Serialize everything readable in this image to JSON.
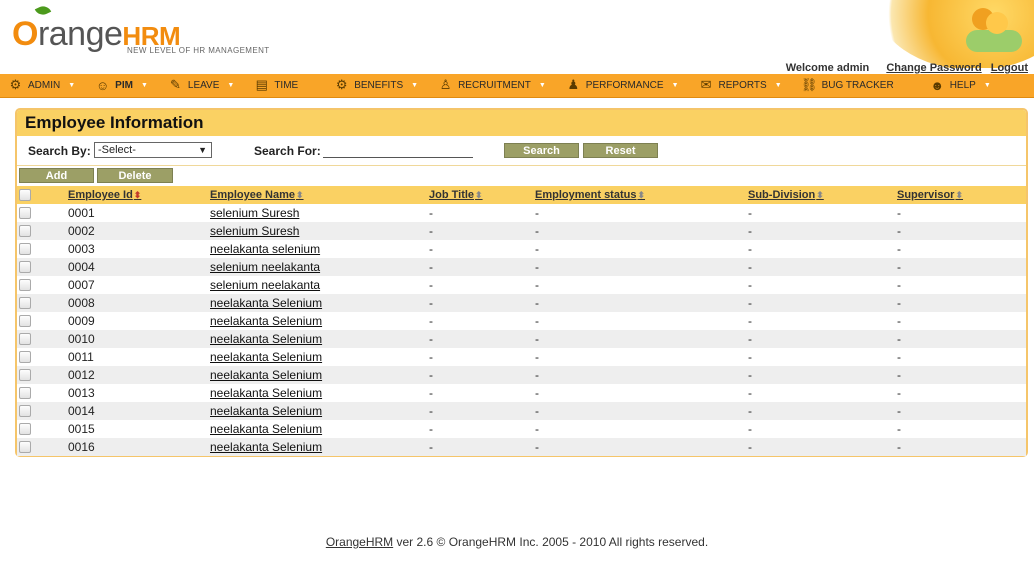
{
  "brand": {
    "logo_prefix": "O",
    "logo_word": "range",
    "logo_suffix": "HRM",
    "tagline": "NEW LEVEL OF HR MANAGEMENT"
  },
  "user_bar": {
    "welcome": "Welcome admin",
    "change_password": "Change Password",
    "logout": "Logout"
  },
  "menu": [
    {
      "label": "Admin",
      "icon": "admin-icon",
      "glyph": "⚙",
      "has_dropdown": true
    },
    {
      "label": "PIM",
      "icon": "pim-icon",
      "glyph": "☺",
      "has_dropdown": true,
      "active": true
    },
    {
      "label": "Leave",
      "icon": "leave-icon",
      "glyph": "✎",
      "has_dropdown": true
    },
    {
      "label": "Time",
      "icon": "time-icon",
      "glyph": "▤",
      "has_dropdown": false
    },
    {
      "label": "Benefits",
      "icon": "benefits-icon",
      "glyph": "⚙",
      "has_dropdown": true
    },
    {
      "label": "Recruitment",
      "icon": "recruitment-icon",
      "glyph": "♙",
      "has_dropdown": true
    },
    {
      "label": "Performance",
      "icon": "performance-icon",
      "glyph": "♟",
      "has_dropdown": true
    },
    {
      "label": "Reports",
      "icon": "reports-icon",
      "glyph": "✉",
      "has_dropdown": true
    },
    {
      "label": "Bug Tracker",
      "icon": "bug-tracker-icon",
      "glyph": "⛓",
      "has_dropdown": false
    },
    {
      "label": "Help",
      "icon": "help-icon",
      "glyph": "☻",
      "has_dropdown": true
    }
  ],
  "panel": {
    "title": "Employee Information",
    "search_by_label": "Search By:",
    "search_by_value": "-Select-",
    "search_for_label": "Search For:",
    "search_for_value": "",
    "search_button": "Search",
    "reset_button": "Reset",
    "add_button": "Add",
    "delete_button": "Delete"
  },
  "table": {
    "columns": [
      "Employee Id",
      "Employee Name",
      "Job Title",
      "Employment status",
      "Sub-Division",
      "Supervisor"
    ],
    "rows": [
      {
        "id": "0001",
        "name": "selenium Suresh",
        "job": "-",
        "status": "-",
        "sub": "-",
        "sup": "-"
      },
      {
        "id": "0002",
        "name": "selenium Suresh",
        "job": "-",
        "status": "-",
        "sub": "-",
        "sup": "-"
      },
      {
        "id": "0003",
        "name": "neelakanta selenium",
        "job": "-",
        "status": "-",
        "sub": "-",
        "sup": "-"
      },
      {
        "id": "0004",
        "name": "selenium neelakanta",
        "job": "-",
        "status": "-",
        "sub": "-",
        "sup": "-"
      },
      {
        "id": "0007",
        "name": "selenium neelakanta",
        "job": "-",
        "status": "-",
        "sub": "-",
        "sup": "-"
      },
      {
        "id": "0008",
        "name": "neelakanta Selenium",
        "job": "-",
        "status": "-",
        "sub": "-",
        "sup": "-"
      },
      {
        "id": "0009",
        "name": "neelakanta Selenium",
        "job": "-",
        "status": "-",
        "sub": "-",
        "sup": "-"
      },
      {
        "id": "0010",
        "name": "neelakanta Selenium",
        "job": "-",
        "status": "-",
        "sub": "-",
        "sup": "-"
      },
      {
        "id": "0011",
        "name": "neelakanta Selenium",
        "job": "-",
        "status": "-",
        "sub": "-",
        "sup": "-"
      },
      {
        "id": "0012",
        "name": "neelakanta Selenium",
        "job": "-",
        "status": "-",
        "sub": "-",
        "sup": "-"
      },
      {
        "id": "0013",
        "name": "neelakanta Selenium",
        "job": "-",
        "status": "-",
        "sub": "-",
        "sup": "-"
      },
      {
        "id": "0014",
        "name": "neelakanta Selenium",
        "job": "-",
        "status": "-",
        "sub": "-",
        "sup": "-"
      },
      {
        "id": "0015",
        "name": "neelakanta Selenium",
        "job": "-",
        "status": "-",
        "sub": "-",
        "sup": "-"
      },
      {
        "id": "0016",
        "name": "neelakanta Selenium",
        "job": "-",
        "status": "-",
        "sub": "-",
        "sup": "-"
      }
    ]
  },
  "footer": {
    "link": "OrangeHRM",
    "text": " ver 2.6 © OrangeHRM Inc. 2005 - 2010 All rights reserved."
  },
  "colors": {
    "menu_bar": "#f9a528",
    "panel_header": "#fad163",
    "button": "#9c9f66",
    "row_alt": "#eeeeee"
  }
}
